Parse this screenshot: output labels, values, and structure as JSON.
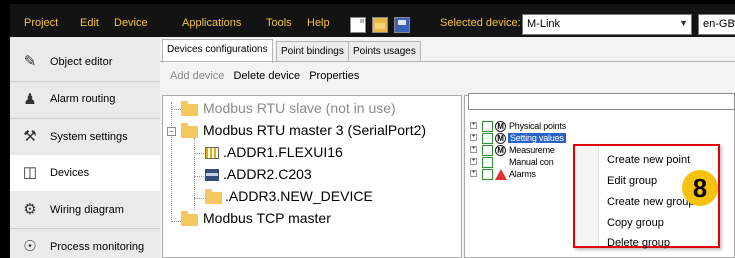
{
  "menubar": {
    "items": [
      "Project",
      "Edit",
      "Device",
      "Applications",
      "Tools",
      "Help"
    ],
    "icons": [
      "new-file-icon",
      "open-folder-icon",
      "save-icon"
    ],
    "selected_device_label": "Selected device:",
    "selected_device_value": "M-Link",
    "locale_value": "en-GB"
  },
  "nav": {
    "items": [
      {
        "label": "Object editor",
        "icon": "pencil-icon"
      },
      {
        "label": "Alarm routing",
        "icon": "people-icon"
      },
      {
        "label": "System settings",
        "icon": "tools-icon"
      },
      {
        "label": "Devices",
        "icon": "network-icon",
        "active": true
      },
      {
        "label": "Wiring diagram",
        "icon": "wiring-icon"
      },
      {
        "label": "Process monitoring",
        "icon": "monitor-icon"
      }
    ]
  },
  "tabs": [
    "Devices configurations",
    "Point bindings",
    "Points usages"
  ],
  "toolbar": {
    "add_device": "Add device",
    "delete_device": "Delete device",
    "properties": "Properties"
  },
  "tree": {
    "items": [
      {
        "label": "Modbus RTU slave (not in use)",
        "dimmed": true
      },
      {
        "label": "Modbus RTU master 3 (SerialPort2)"
      },
      {
        "label": ".ADDR1.FLEXUI16"
      },
      {
        "label": ".ADDR2.C203"
      },
      {
        "label": ".ADDR3.NEW_DEVICE"
      },
      {
        "label": "Modbus TCP master"
      }
    ]
  },
  "points_tree": {
    "items": [
      {
        "label": "Physical points"
      },
      {
        "label": "Setting values",
        "selected": true
      },
      {
        "label": "Measureme"
      },
      {
        "label": "Manual con"
      },
      {
        "label": "Alarms"
      }
    ]
  },
  "context_menu": {
    "items": [
      "Create new point",
      "Edit group",
      "Create new group",
      "Copy group",
      "Delete group"
    ],
    "callout": "8"
  },
  "colors": {
    "menubar_bg": "#131313",
    "menu_text": "#f0c240",
    "highlight_border": "#e00000",
    "callout_badge": "#f6c20e",
    "selection": "#2a62c8"
  }
}
